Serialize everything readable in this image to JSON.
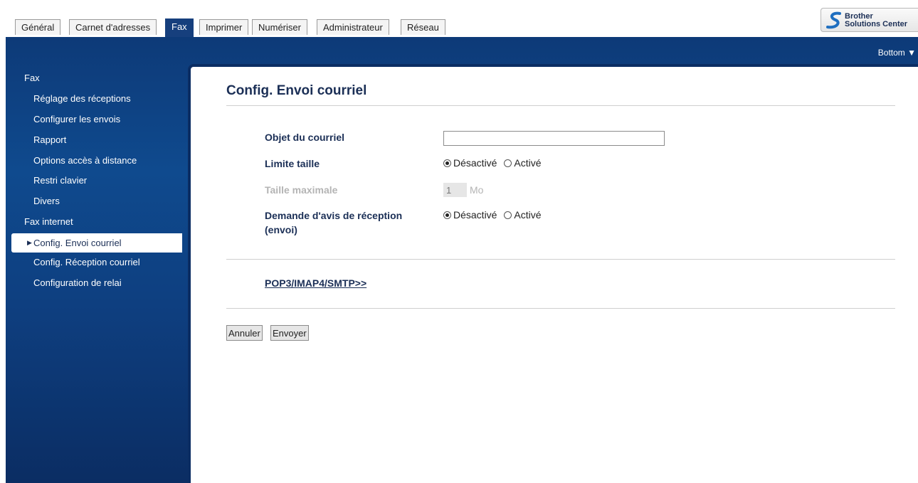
{
  "tabs": [
    {
      "label": "Général"
    },
    {
      "label": "Carnet d'adresses"
    },
    {
      "label": "Fax"
    },
    {
      "label": "Imprimer"
    },
    {
      "label": "Numériser"
    },
    {
      "label": "Administrateur"
    },
    {
      "label": "Réseau"
    }
  ],
  "active_tab": "Fax",
  "logo": {
    "line1": "Brother",
    "line2": "Solutions Center"
  },
  "bottom_link": "Bottom ▼",
  "sidebar": {
    "section_fax": "Fax",
    "fax_items": [
      {
        "label": "Réglage des réceptions"
      },
      {
        "label": "Configurer les envois"
      },
      {
        "label": "Rapport"
      },
      {
        "label": "Options accès à distance"
      },
      {
        "label": "Restri clavier"
      },
      {
        "label": "Divers"
      }
    ],
    "section_internet": "Fax internet",
    "internet_items": [
      {
        "label": "Config. Envoi courriel"
      },
      {
        "label": "Config. Réception courriel"
      },
      {
        "label": "Configuration de relai"
      }
    ],
    "active_item": "Config. Envoi courriel"
  },
  "main": {
    "title": "Config. Envoi courriel",
    "fields": {
      "subject_label": "Objet du courriel",
      "subject_value": "",
      "size_limit_label": "Limite taille",
      "max_size_label": "Taille maximale",
      "max_size_value": "1",
      "max_size_unit": "Mo",
      "receipt_label_line1": "Demande d'avis de réception",
      "receipt_label_line2": "(envoi)"
    },
    "options": {
      "off": "Désactivé",
      "on": "Activé"
    },
    "size_limit_selected": "Désactivé",
    "receipt_selected": "Désactivé",
    "pop3_link": "POP3/IMAP4/SMTP>>",
    "cancel_button": "Annuler",
    "submit_button": "Envoyer"
  },
  "colors": {
    "brand_blue": "#163f7d",
    "title_text": "#1b2f56"
  }
}
